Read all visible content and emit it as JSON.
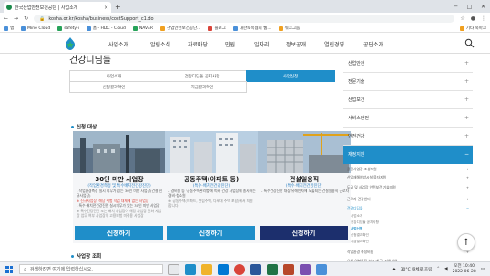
{
  "browser": {
    "tab_title": "한국산업안전보건공단 | 사업소개",
    "new_tab": "+",
    "tab_close": "×",
    "url": "kosha.or.kr/kosha/business/costSupport_c1.do",
    "bookmarks": [
      "앱",
      "Mine Cloud",
      "safety-i",
      "홈 - HDC - Cloud",
      "NAVER",
      "산업안전보건공단...",
      "블로그",
      "대한토목협회 웹...",
      "워크그룹"
    ],
    "bookmarks_right": "기타 북마크"
  },
  "gnb": {
    "menu": [
      "사업소개",
      "알림소식",
      "자료마당",
      "민원",
      "일자리",
      "정보공개",
      "열린경영",
      "공단소개"
    ]
  },
  "page": {
    "title": "건강디딤돌",
    "subtabs": [
      "사업소개",
      "건강디딤돌 공지사항",
      "사업신청",
      "신청결과확인",
      "지급결과확인"
    ],
    "section_title": "신청 대상",
    "section2_title": "사업장 조회"
  },
  "cards": [
    {
      "heading": "30인 미만 사업장",
      "sub": "(작업환경측정 및 특수배치전건강진단)",
      "body": [
        "- 작업환경측정 실시 의무가 있는 30인 미만 사업장(건설 신규사업장)",
        "※ 신규사업장: 해당 위험 작업 대체에 없는 사업장",
        "- 특수·배치전건강진단 실시의무가 있는 30인 미만 사업장",
        "※ 특수건강진단 또는 배치 사업장이 해당 사업장 전화 사업장 업무 여부 사업장이 고용보험 미적용 사업장"
      ],
      "button": "신청하기"
    },
    {
      "heading": "공동주택(아파트 등)",
      "sub": "(특수·배치전건강진단)",
      "body": [
        "- 경비원 등 '공동주택관리법'에 따라 건강 사업장에 종사하는 경비·청소원",
        "※ 공동주택(아파트, 연립주택, 다세대 주택 포함)에서 지원합니다."
      ],
      "button": "신청하기"
    },
    {
      "heading": "건설일용직",
      "sub": "(특수·배치전건강진단)",
      "body": [
        "- 특수건강진단 대상 유해인자에 노출되는 건설일용직 근로자"
      ],
      "button": "신청하기"
    }
  ],
  "sidebar": {
    "items": [
      "산업안전",
      "전문기술",
      "산업보건",
      "서비스안전",
      "안전건강"
    ],
    "active": "재정지원",
    "subitems": [
      "클린사업장 조성지원",
      "산업재해예방시설 융자지원",
      "도급 및 사업장 안전보건 기술지원",
      "근로자 건강센터"
    ],
    "subgroup": "건강디딤돌",
    "subsub": [
      "사업소개",
      "건강디딤돌 공지사항",
      "사업신청",
      "신청결과확인",
      "지급결과확인"
    ],
    "more": [
      "작업환경 측정비용",
      "유해·위험물질 보고(취급) 지원사업"
    ]
  },
  "top_button": "↑",
  "taskbar": {
    "search": "검색하려면 여기에 입력하십시오.",
    "weather": "30°C 대체로 흐림",
    "time": "오전 10:40",
    "date": "2022-06-28"
  }
}
